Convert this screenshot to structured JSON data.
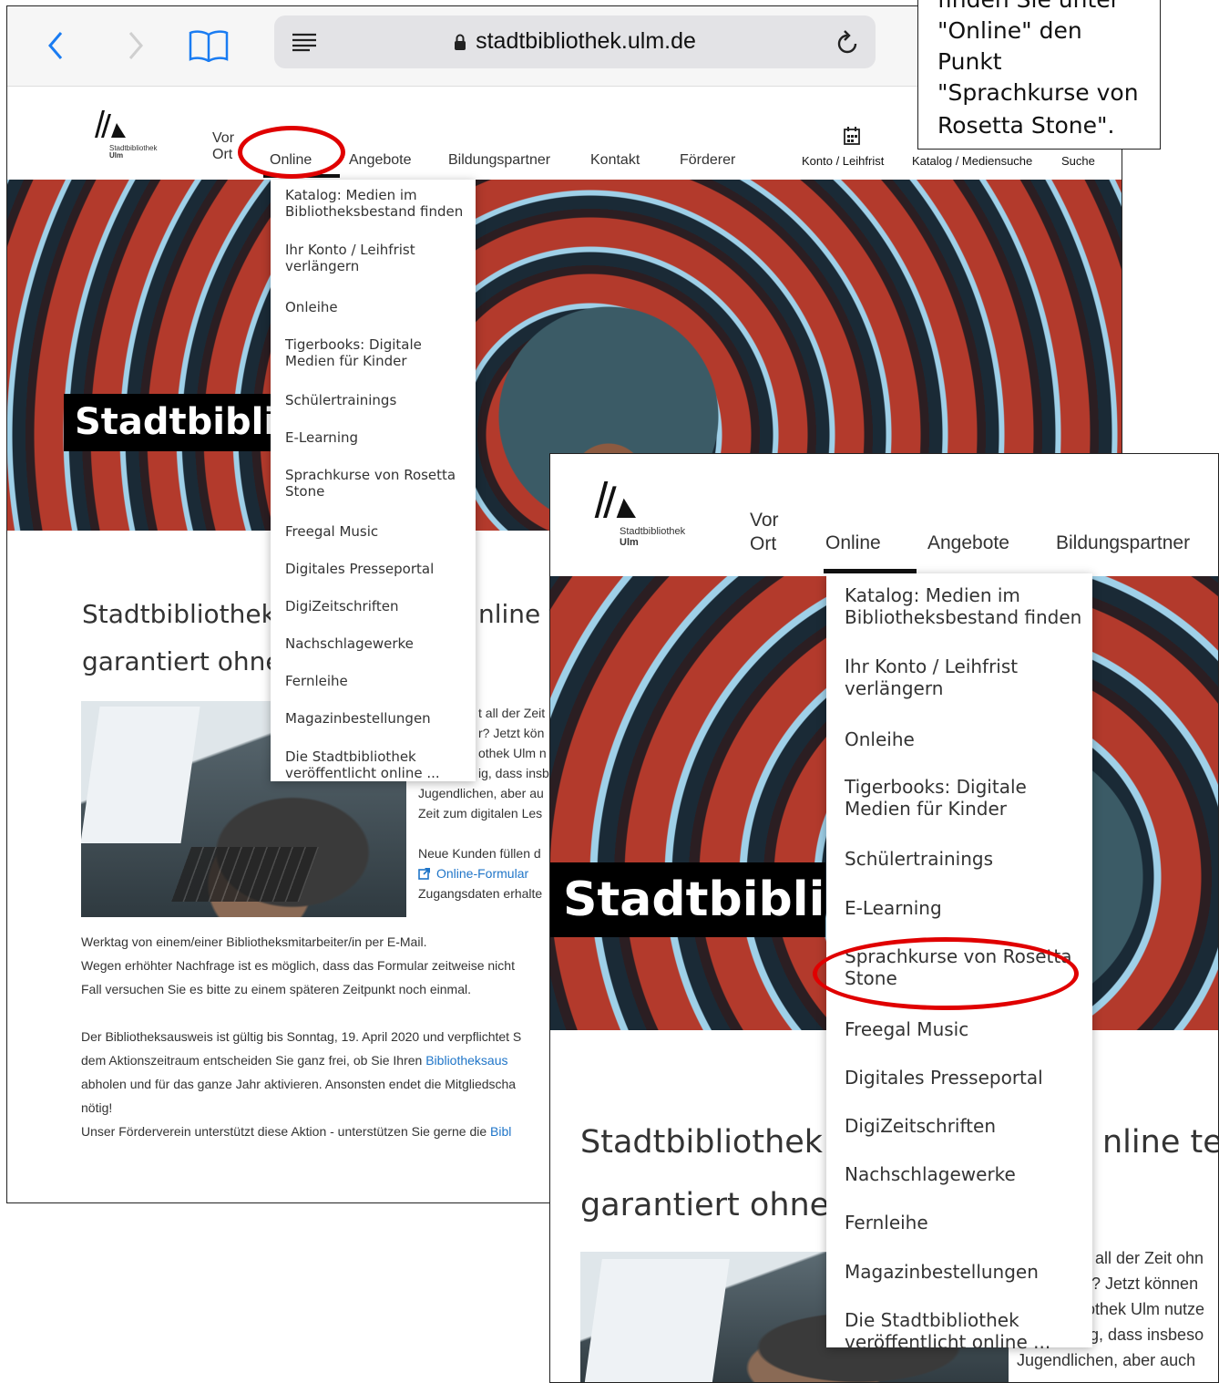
{
  "browser": {
    "url": "stadtbibliothek.ulm.de",
    "icons": [
      "back-icon",
      "forward-icon",
      "bookmarks-icon",
      "reader-icon",
      "lock-icon",
      "reload-icon"
    ]
  },
  "site": {
    "logo_line1": "Stadtbibliothek",
    "logo_line2": "Ulm",
    "nav": {
      "vor": "Vor",
      "ort": "Ort",
      "online": "Online",
      "angebote": "Angebote",
      "bildungspartner": "Bildungspartner",
      "kontakt": "Kontakt",
      "foerderer": "Förderer",
      "konto": "Konto / Leihfrist",
      "katalog": "Katalog / Mediensuche",
      "suche": "Suche"
    },
    "hero_title": "Stadtbibliothek",
    "dropdown": [
      [
        "Katalog: Medien im",
        "Bibliotheksbestand finden"
      ],
      [
        "Ihr Konto / Leihfrist",
        "verlängern"
      ],
      [
        "Onleihe"
      ],
      [
        "Tigerbooks: Digitale",
        "Medien für Kinder"
      ],
      [
        "Schülertrainings"
      ],
      [
        "E-Learning"
      ],
      [
        "Sprachkurse von Rosetta",
        "Stone"
      ],
      [
        "Freegal Music"
      ],
      [
        "Digitales Presseportal"
      ],
      [
        "DigiZeitschriften"
      ],
      [
        "Nachschlagewerke"
      ],
      [
        "Fernleihe"
      ],
      [
        "Magazinbestellungen"
      ],
      [
        "Die Stadtbibliothek",
        "veröffentlicht online ..."
      ]
    ],
    "heading_line1_left": "Stadtbibliothek",
    "heading_line1_right": "nline te",
    "heading_line1_right_zoom": "nline tes",
    "heading_line2": "garantiert ohne",
    "body_right": {
      "p1_l1": "t all der Zeit",
      "p1_l1_zoom": "t all der Zeit ohn",
      "p1_l2": "r? Jetzt kön",
      "p1_l2_zoom": "r? Jetzt können",
      "p1_l3": "othek Ulm n",
      "p1_l3_zoom": "othek Ulm nutze",
      "p1_l4": "ig, dass insb",
      "p1_l4_zoom": "ig, dass insbeso",
      "p1_l5": "Jugendlichen, aber au",
      "p1_l5_zoom": "Jugendlichen, aber auch",
      "p1_l6": "Zeit zum digitalen Les",
      "p2_l1": "Neue Kunden füllen d",
      "p2_l2_link": "Online-Formular",
      "p2_l3": "Zugangsdaten erhalte"
    },
    "body_full": [
      "Werktag von einem/einer Bibliotheksmitarbeiter/in per E-Mail.",
      "Wegen erhöhter Nachfrage ist es möglich, dass das Formular zeitweise nicht",
      "Fall versuchen Sie es bitte zu einem späteren Zeitpunkt noch einmal."
    ],
    "body_full2_l1": "Der Bibliotheksausweis ist gültig bis Sonntag, 19. April 2020 und verpflichtet S",
    "body_full2_l2": "dem Aktionszeitraum entscheiden Sie ganz frei, ob Sie Ihren ",
    "body_full2_l2_link": "Bibliotheksaus",
    "body_full2_l3": "abholen und für das ganze Jahr aktivieren. Ansonsten endet die Mitgliedscha",
    "body_full2_l4": "nötig!",
    "body_full2_l5": "Unser Förderverein unterstützt diese Aktion - unterstützen Sie gerne die ",
    "body_full2_l5_link": "Bibl"
  },
  "note": {
    "lines": [
      "finden Sie unter",
      "\"Online\" den",
      "Punkt",
      "\"Sprachkurse von",
      "Rosetta Stone\"."
    ]
  },
  "colors": {
    "highlight": "#e00000",
    "link": "#1f75c8"
  }
}
